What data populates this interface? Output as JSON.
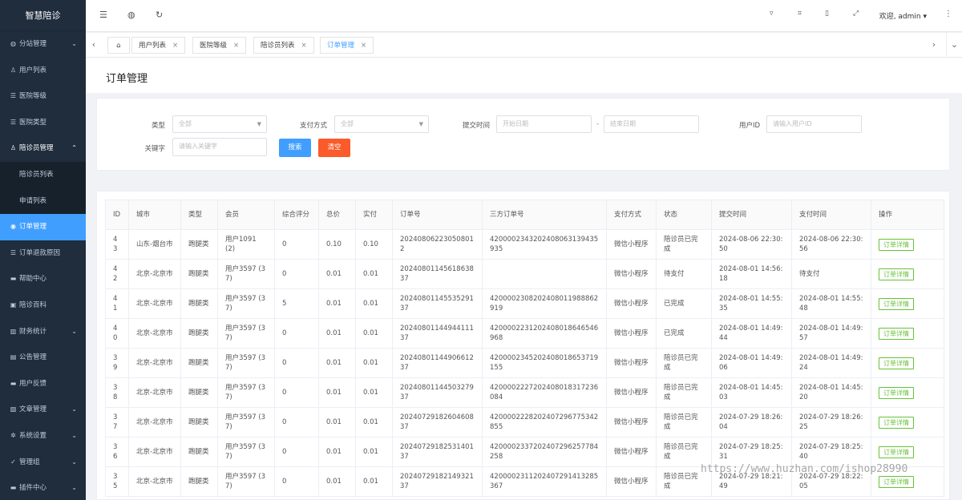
{
  "brand": "智慧陪诊",
  "sidebar": {
    "items": [
      {
        "icon": "globe-icon",
        "glyph": "◍",
        "label": "分站管理",
        "arrow": "⌄"
      },
      {
        "icon": "user-icon",
        "glyph": "♙",
        "label": "用户列表",
        "arrow": ""
      },
      {
        "icon": "list-icon",
        "glyph": "☰",
        "label": "医院等级",
        "arrow": ""
      },
      {
        "icon": "list-icon",
        "glyph": "☰",
        "label": "医院类型",
        "arrow": ""
      },
      {
        "icon": "user-icon",
        "glyph": "♙",
        "label": "陪诊员管理",
        "arrow": "⌃"
      },
      {
        "icon": "",
        "glyph": "",
        "label": "陪诊员列表",
        "arrow": ""
      },
      {
        "icon": "",
        "glyph": "",
        "label": "申请列表",
        "arrow": ""
      },
      {
        "icon": "order-icon",
        "glyph": "◉",
        "label": "订单管理",
        "arrow": ""
      },
      {
        "icon": "list-icon",
        "glyph": "☰",
        "label": "订单退款原因",
        "arrow": ""
      },
      {
        "icon": "help-icon",
        "glyph": "▬",
        "label": "帮助中心",
        "arrow": ""
      },
      {
        "icon": "book-icon",
        "glyph": "▣",
        "label": "陪诊百科",
        "arrow": ""
      },
      {
        "icon": "finance-icon",
        "glyph": "▥",
        "label": "财务统计",
        "arrow": "⌄"
      },
      {
        "icon": "notice-icon",
        "glyph": "▤",
        "label": "公告管理",
        "arrow": ""
      },
      {
        "icon": "feedback-icon",
        "glyph": "▬",
        "label": "用户反馈",
        "arrow": ""
      },
      {
        "icon": "article-icon",
        "glyph": "▧",
        "label": "文章管理",
        "arrow": "⌄"
      },
      {
        "icon": "settings-icon",
        "glyph": "✲",
        "label": "系统设置",
        "arrow": "⌄"
      },
      {
        "icon": "admin-icon",
        "glyph": "✓",
        "label": "管理组",
        "arrow": "⌄"
      },
      {
        "icon": "plugin-icon",
        "glyph": "▬",
        "label": "插件中心",
        "arrow": "⌄"
      }
    ]
  },
  "header": {
    "welcome": "欢迎, admin ▾",
    "icons": [
      "menu-fold-icon",
      "globe-icon",
      "refresh-icon",
      "trash-icon",
      "crop-icon",
      "file-icon",
      "fullscreen-icon",
      "more-icon"
    ]
  },
  "tabs": {
    "home_icon": "home-icon",
    "items": [
      {
        "label": "用户列表"
      },
      {
        "label": "医院等级"
      },
      {
        "label": "陪诊员列表"
      },
      {
        "label": "订单管理",
        "active": true
      }
    ]
  },
  "page": {
    "title": "订单管理"
  },
  "filters": {
    "type_label": "类型",
    "type_value": "全部",
    "pay_label": "支付方式",
    "pay_value": "全部",
    "submit_time_label": "提交时间",
    "start_date_placeholder": "开始日期",
    "date_separator": "-",
    "end_date_placeholder": "结束日期",
    "user_id_label": "用户ID",
    "user_id_placeholder": "请输入用户ID",
    "keyword_label": "关键字",
    "keyword_placeholder": "请输入关键字",
    "search_button": "搜索",
    "clear_button": "清空"
  },
  "table": {
    "headers": [
      "ID",
      "城市",
      "类型",
      "会员",
      "综合评分",
      "总价",
      "实付",
      "订单号",
      "三方订单号",
      "支付方式",
      "状态",
      "提交时间",
      "支付时间",
      "操作"
    ],
    "rows": [
      {
        "id": "43",
        "city": "山东-烟台市",
        "type": "跑腿类",
        "member": "用户1091 (2)",
        "score": "0",
        "total": "0.10",
        "paid": "0.10",
        "order_no": "202408062230508012",
        "third_no": "4200002343202408063139435935",
        "pay_method": "微信小程序",
        "status": "陪诊员已完成",
        "submit_time": "2024-08-06 22:30:50",
        "pay_time": "2024-08-06 22:30:56",
        "op": "订单详情"
      },
      {
        "id": "42",
        "city": "北京-北京市",
        "type": "跑腿类",
        "member": "用户3597 (37)",
        "score": "0",
        "total": "0.01",
        "paid": "0.01",
        "order_no": "202408011456186383​7",
        "third_no": "",
        "pay_method": "微信小程序",
        "status": "待支付",
        "submit_time": "2024-08-01 14:56:18",
        "pay_time": "待支付",
        "op": "订单详情"
      },
      {
        "id": "41",
        "city": "北京-北京市",
        "type": "跑腿类",
        "member": "用户3597 (37)",
        "score": "5",
        "total": "0.01",
        "paid": "0.01",
        "order_no": "202408011455352913​7",
        "third_no": "4200002308202408011988862919",
        "pay_method": "微信小程序",
        "status": "已完成",
        "submit_time": "2024-08-01 14:55:35",
        "pay_time": "2024-08-01 14:55:48",
        "op": "订单详情"
      },
      {
        "id": "40",
        "city": "北京-北京市",
        "type": "跑腿类",
        "member": "用户3597 (37)",
        "score": "0",
        "total": "0.01",
        "paid": "0.01",
        "order_no": "202408011449441113​7",
        "third_no": "4200002231202408018646546968",
        "pay_method": "微信小程序",
        "status": "已完成",
        "submit_time": "2024-08-01 14:49:44",
        "pay_time": "2024-08-01 14:49:57",
        "op": "订单详情"
      },
      {
        "id": "39",
        "city": "北京-北京市",
        "type": "跑腿类",
        "member": "用户3597 (37)",
        "score": "0",
        "total": "0.01",
        "paid": "0.01",
        "order_no": "202408011449066123​7",
        "third_no": "4200002345202408018653719155",
        "pay_method": "微信小程序",
        "status": "陪诊员已完成",
        "submit_time": "2024-08-01 14:49:06",
        "pay_time": "2024-08-01 14:49:24",
        "op": "订单详情"
      },
      {
        "id": "38",
        "city": "北京-北京市",
        "type": "跑腿类",
        "member": "用户3597 (37)",
        "score": "0",
        "total": "0.01",
        "paid": "0.01",
        "order_no": "202408011445032793​7",
        "third_no": "4200002227202408018317236084",
        "pay_method": "微信小程序",
        "status": "陪诊员已完成",
        "submit_time": "2024-08-01 14:45:03",
        "pay_time": "2024-08-01 14:45:20",
        "op": "订单详情"
      },
      {
        "id": "37",
        "city": "北京-北京市",
        "type": "跑腿类",
        "member": "用户3597 (37)",
        "score": "0",
        "total": "0.01",
        "paid": "0.01",
        "order_no": "202407291826046083​7",
        "third_no": "4200002228202407296775342855",
        "pay_method": "微信小程序",
        "status": "陪诊员已完成",
        "submit_time": "2024-07-29 18:26:04",
        "pay_time": "2024-07-29 18:26:25",
        "op": "订单详情"
      },
      {
        "id": "36",
        "city": "北京-北京市",
        "type": "跑腿类",
        "member": "用户3597 (37)",
        "score": "0",
        "total": "0.01",
        "paid": "0.01",
        "order_no": "202407291825314013​7",
        "third_no": "4200002337202407296257784258",
        "pay_method": "微信小程序",
        "status": "陪诊员已完成",
        "submit_time": "2024-07-29 18:25:31",
        "pay_time": "2024-07-29 18:25:40",
        "op": "订单详情"
      },
      {
        "id": "35",
        "city": "北京-北京市",
        "type": "跑腿类",
        "member": "用户3597 (37)",
        "score": "0",
        "total": "0.01",
        "paid": "0.01",
        "order_no": "202407291821493213​7",
        "third_no": "4200002311202407291413285367",
        "pay_method": "微信小程序",
        "status": "陪诊员已完成",
        "submit_time": "2024-07-29 18:21:49",
        "pay_time": "2024-07-29 18:22:05",
        "op": "订单详情"
      }
    ]
  },
  "watermark": "https://www.huzhan.com/ishop28990"
}
